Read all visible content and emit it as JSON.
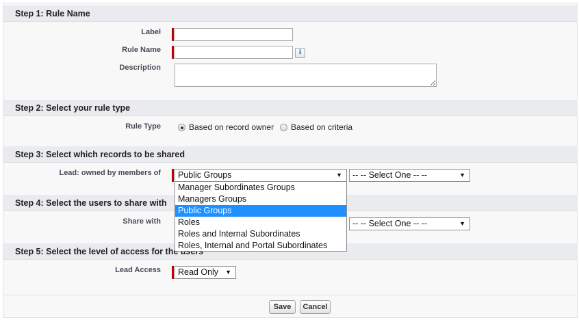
{
  "step1": {
    "header": "Step 1: Rule Name",
    "label_label": "Label",
    "rule_name_label": "Rule Name",
    "description_label": "Description",
    "info_icon_glyph": "i"
  },
  "step2": {
    "header": "Step 2: Select your rule type",
    "rule_type_label": "Rule Type",
    "option_owner": "Based on record owner",
    "option_criteria": "Based on criteria",
    "selected": "owner"
  },
  "step3": {
    "header": "Step 3: Select which records to be shared",
    "owned_by_label": "Lead: owned by members of",
    "group_type_value": "Public Groups",
    "group_select_value": "-- -- Select One -- --",
    "dropdown_options": [
      "Manager Subordinates Groups",
      "Managers Groups",
      "Public Groups",
      "Roles",
      "Roles and Internal Subordinates",
      "Roles, Internal and Portal Subordinates"
    ],
    "dropdown_selected_index": 2
  },
  "step4": {
    "header": "Step 4: Select the users to share with",
    "share_with_label": "Share with",
    "share_with_group_value": "-- -- Select One -- --"
  },
  "step5": {
    "header": "Step 5: Select the level of access for the users",
    "lead_access_label": "Lead Access",
    "lead_access_value": "Read Only"
  },
  "buttons": {
    "save": "Save",
    "cancel": "Cancel"
  },
  "colors": {
    "required_bar": "#c00000",
    "header_bg": "#e9ebee",
    "selection": "#1e90ff"
  }
}
